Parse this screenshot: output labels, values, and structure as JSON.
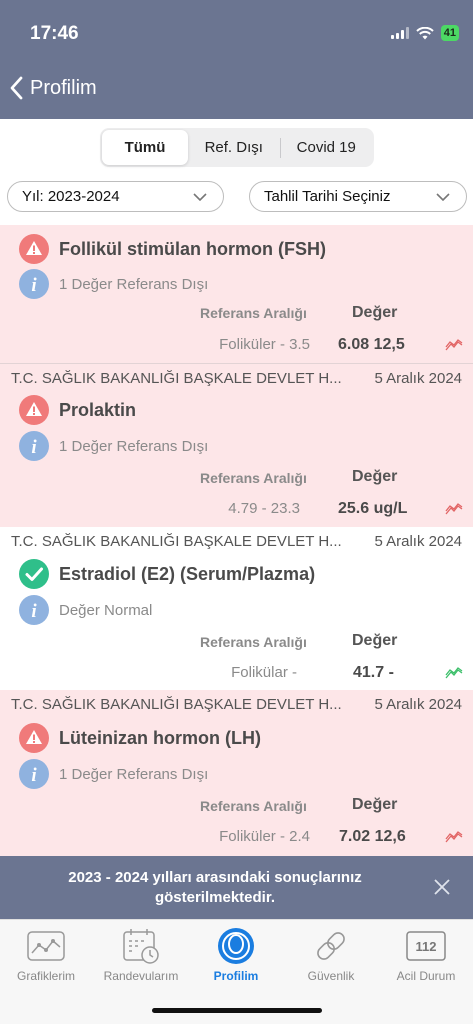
{
  "status": {
    "time": "17:46",
    "battery": "41"
  },
  "nav": {
    "title": "Profilim",
    "back_icon": "chevron-left-icon"
  },
  "segments": [
    {
      "label": "Tümü",
      "active": true
    },
    {
      "label": "Ref. Dışı",
      "active": false
    },
    {
      "label": "Covid 19",
      "active": false
    }
  ],
  "filters": {
    "year": "Yıl: 2023-2024",
    "date": "Tahlil Tarihi Seçiniz"
  },
  "columns": {
    "ref": "Referans Aralığı",
    "value": "Değer"
  },
  "results": [
    {
      "source": "",
      "date": "",
      "status": "warning",
      "title": "Follikül stimülan hormon (FSH)",
      "info": "1 Değer Referans Dışı",
      "ref": "Foliküler - 3.5",
      "value": "6.08 12,5"
    },
    {
      "source": "T.C. SAĞLIK BAKANLIĞI BAŞKALE DEVLET H...",
      "date": "5 Aralık 2024",
      "status": "warning",
      "title": "Prolaktin",
      "info": "1 Değer Referans Dışı",
      "ref": "4.79 - 23.3",
      "value": "25.6 ug/L"
    },
    {
      "source": "T.C. SAĞLIK BAKANLIĞI BAŞKALE DEVLET H...",
      "date": "5 Aralık 2024",
      "status": "ok",
      "title": "Estradiol (E2) (Serum/Plazma)",
      "info": "Değer Normal",
      "ref": "Folikülar -",
      "value": "41.7 -"
    },
    {
      "source": "T.C. SAĞLIK BAKANLIĞI BAŞKALE DEVLET H...",
      "date": "5 Aralık 2024",
      "status": "warning",
      "title": "Lüteinizan hormon (LH)",
      "info": "1 Değer Referans Dışı",
      "ref": "Foliküler - 2.4",
      "value": "7.02 12,6"
    }
  ],
  "banner": {
    "text": "2023 - 2024 yılları arasındaki sonuçlarınız gösterilmektedir."
  },
  "tabs": [
    {
      "label": "Grafiklerim",
      "icon": "chart-icon"
    },
    {
      "label": "Randevularım",
      "icon": "calendar-icon"
    },
    {
      "label": "Profilim",
      "icon": "profile-icon",
      "active": true
    },
    {
      "label": "Güvenlik",
      "icon": "link-icon"
    },
    {
      "label": "Acil Durum",
      "icon": "emergency-112-icon",
      "badge": "112"
    }
  ],
  "colors": {
    "header": "#6b7591",
    "warning": "#f07a7a",
    "ok": "#2fbf8a",
    "info": "#8fb2df",
    "accent": "#1a7de0",
    "pink_bg": "#fde6e8"
  }
}
